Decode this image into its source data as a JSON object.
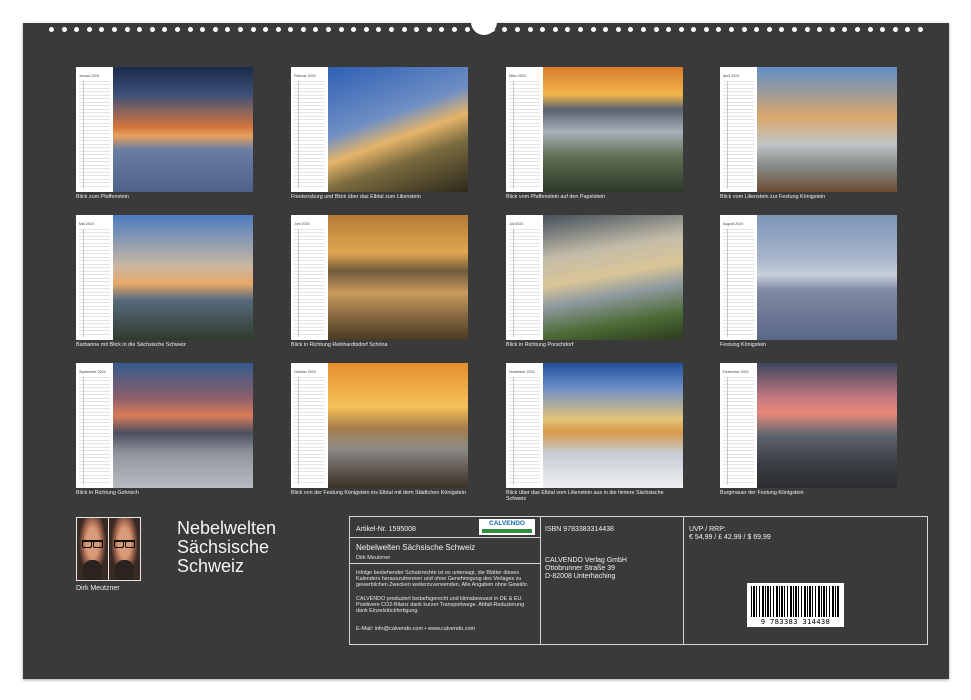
{
  "months": [
    {
      "name": "Januar 2024",
      "caption": "Blick zum Pfaffenstein"
    },
    {
      "name": "Februar 2024",
      "caption": "Friedensburg und Blick über das Elbtal zum Lilienstein"
    },
    {
      "name": "März 2024",
      "caption": "Blick vom Pfaffenstein auf den Papststein"
    },
    {
      "name": "April 2024",
      "caption": "Blick vom Lilienstein zur Festung Königstein"
    },
    {
      "name": "Mai 2024",
      "caption": "Barbarine mit Blick in die Sächsische Schweiz"
    },
    {
      "name": "Juni 2024",
      "caption": "Blick in Richtung Reinhardtsdorf Schöna"
    },
    {
      "name": "Juli 2024",
      "caption": "Blick in Richtung Porschdorf"
    },
    {
      "name": "August 2024",
      "caption": "Festung Königstein"
    },
    {
      "name": "September 2024",
      "caption": "Blick in Richtung Gohrisch"
    },
    {
      "name": "Oktober 2024",
      "caption": "Blick von der Festung Königstein ins Elbtal mit dem Städtchen Königstein"
    },
    {
      "name": "November 2024",
      "caption": "Blick über das Elbtal vom Lilienstein aus in die hintere Sächsische Schweiz"
    },
    {
      "name": "Dezember 2024",
      "caption": "Burgmauer der Festung Königstein"
    }
  ],
  "author": {
    "name": "Dirk Meutzner"
  },
  "title": {
    "line1": "Nebelwelten",
    "line2": "Sächsische",
    "line3": "Schweiz"
  },
  "info": {
    "article_no": "Artikel-Nr. 1595008",
    "logo": "CALVENDO",
    "calendar_title": "Nebelwelten Sächsische Schweiz",
    "author": "Dirk Meutzner",
    "notice1": "Infolge bestehender Schutzrechte ist es untersagt, die Blätter dieses Kalenders herauszutrennen und ohne Genehmigung des Verlages zu gewerblichen Zwecken weiterzuverwenden. Alle Angaben ohne Gewähr.",
    "notice2": "CALVENDO produziert bedarfsgerecht und klimabewusst in DE & EU. Positivere CO2-Bilanz dank kurzer Transportwege. Abfall-Reduzierung dank Einzelstückfertigung.",
    "contact": "E-Mail: info@calvendo.com • www.calvendo.com"
  },
  "publisher": {
    "isbn": "ISBN 9783383314438",
    "name": "CALVENDO Verlag GmbH",
    "street": "Ottobrunner Straße 39",
    "city": "D-82008 Unterhaching"
  },
  "price": {
    "label": "UVP / RRP:",
    "value": "€ 54,99 / £ 42,99 / $ 69,99"
  },
  "barcode": {
    "number": "9 783383 314438"
  },
  "colors": {
    "sheet": "#3a3a3a",
    "logo_blue": "#1a6bb0",
    "logo_green": "#2f8e3f"
  }
}
